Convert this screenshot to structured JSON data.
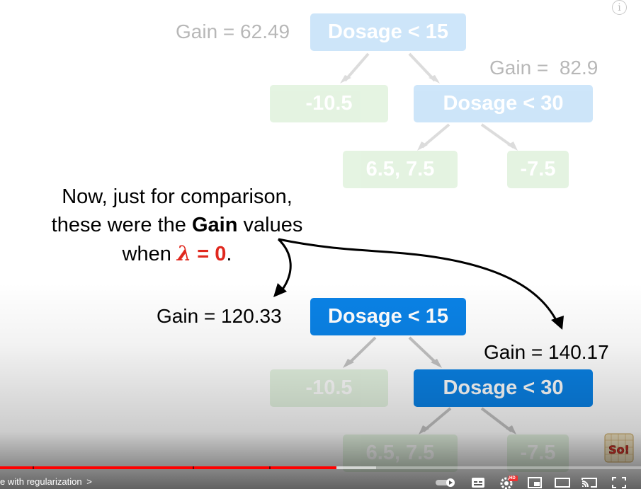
{
  "top_tree": {
    "root_gain": "Gain = 62.49",
    "root_label": "Dosage < 15",
    "left_leaf": "-10.5",
    "right_gain": "Gain =  82.9",
    "right_label": "Dosage < 30",
    "leaf_a": "6.5, 7.5",
    "leaf_b": "-7.5"
  },
  "caption": {
    "line1": "Now, just for comparison,",
    "line2_pre": "these were the ",
    "line2_bold": "Gain",
    "line2_post": " values",
    "line3_pre": "when ",
    "lambda": "λ",
    "lambda_eq": " = 0",
    "line3_post": "."
  },
  "bottom_tree": {
    "root_gain": "Gain = 120.33",
    "root_label": "Dosage < 15",
    "left_leaf": "-10.5",
    "right_gain": "Gain = 140.17",
    "right_label": "Dosage < 30",
    "leaf_a": "6.5, 7.5",
    "leaf_b": "-7.5"
  },
  "player": {
    "chapter_title": "e with regularization",
    "chapter_chevron": ">",
    "hd_badge": "HD",
    "progress_played": 0.525,
    "progress_loaded": 0.587
  },
  "colors": {
    "node_blue": "#0a82e6",
    "leaf_green": "#7cc86e",
    "lambda_red": "#e0281e",
    "progress_red": "#ff0000"
  },
  "logo": {
    "text": "So!"
  },
  "icons": [
    "info-icon",
    "autoplay-toggle-icon",
    "subtitles-icon",
    "settings-gear-icon",
    "miniplayer-icon",
    "theater-mode-icon",
    "cast-icon",
    "fullscreen-icon"
  ]
}
